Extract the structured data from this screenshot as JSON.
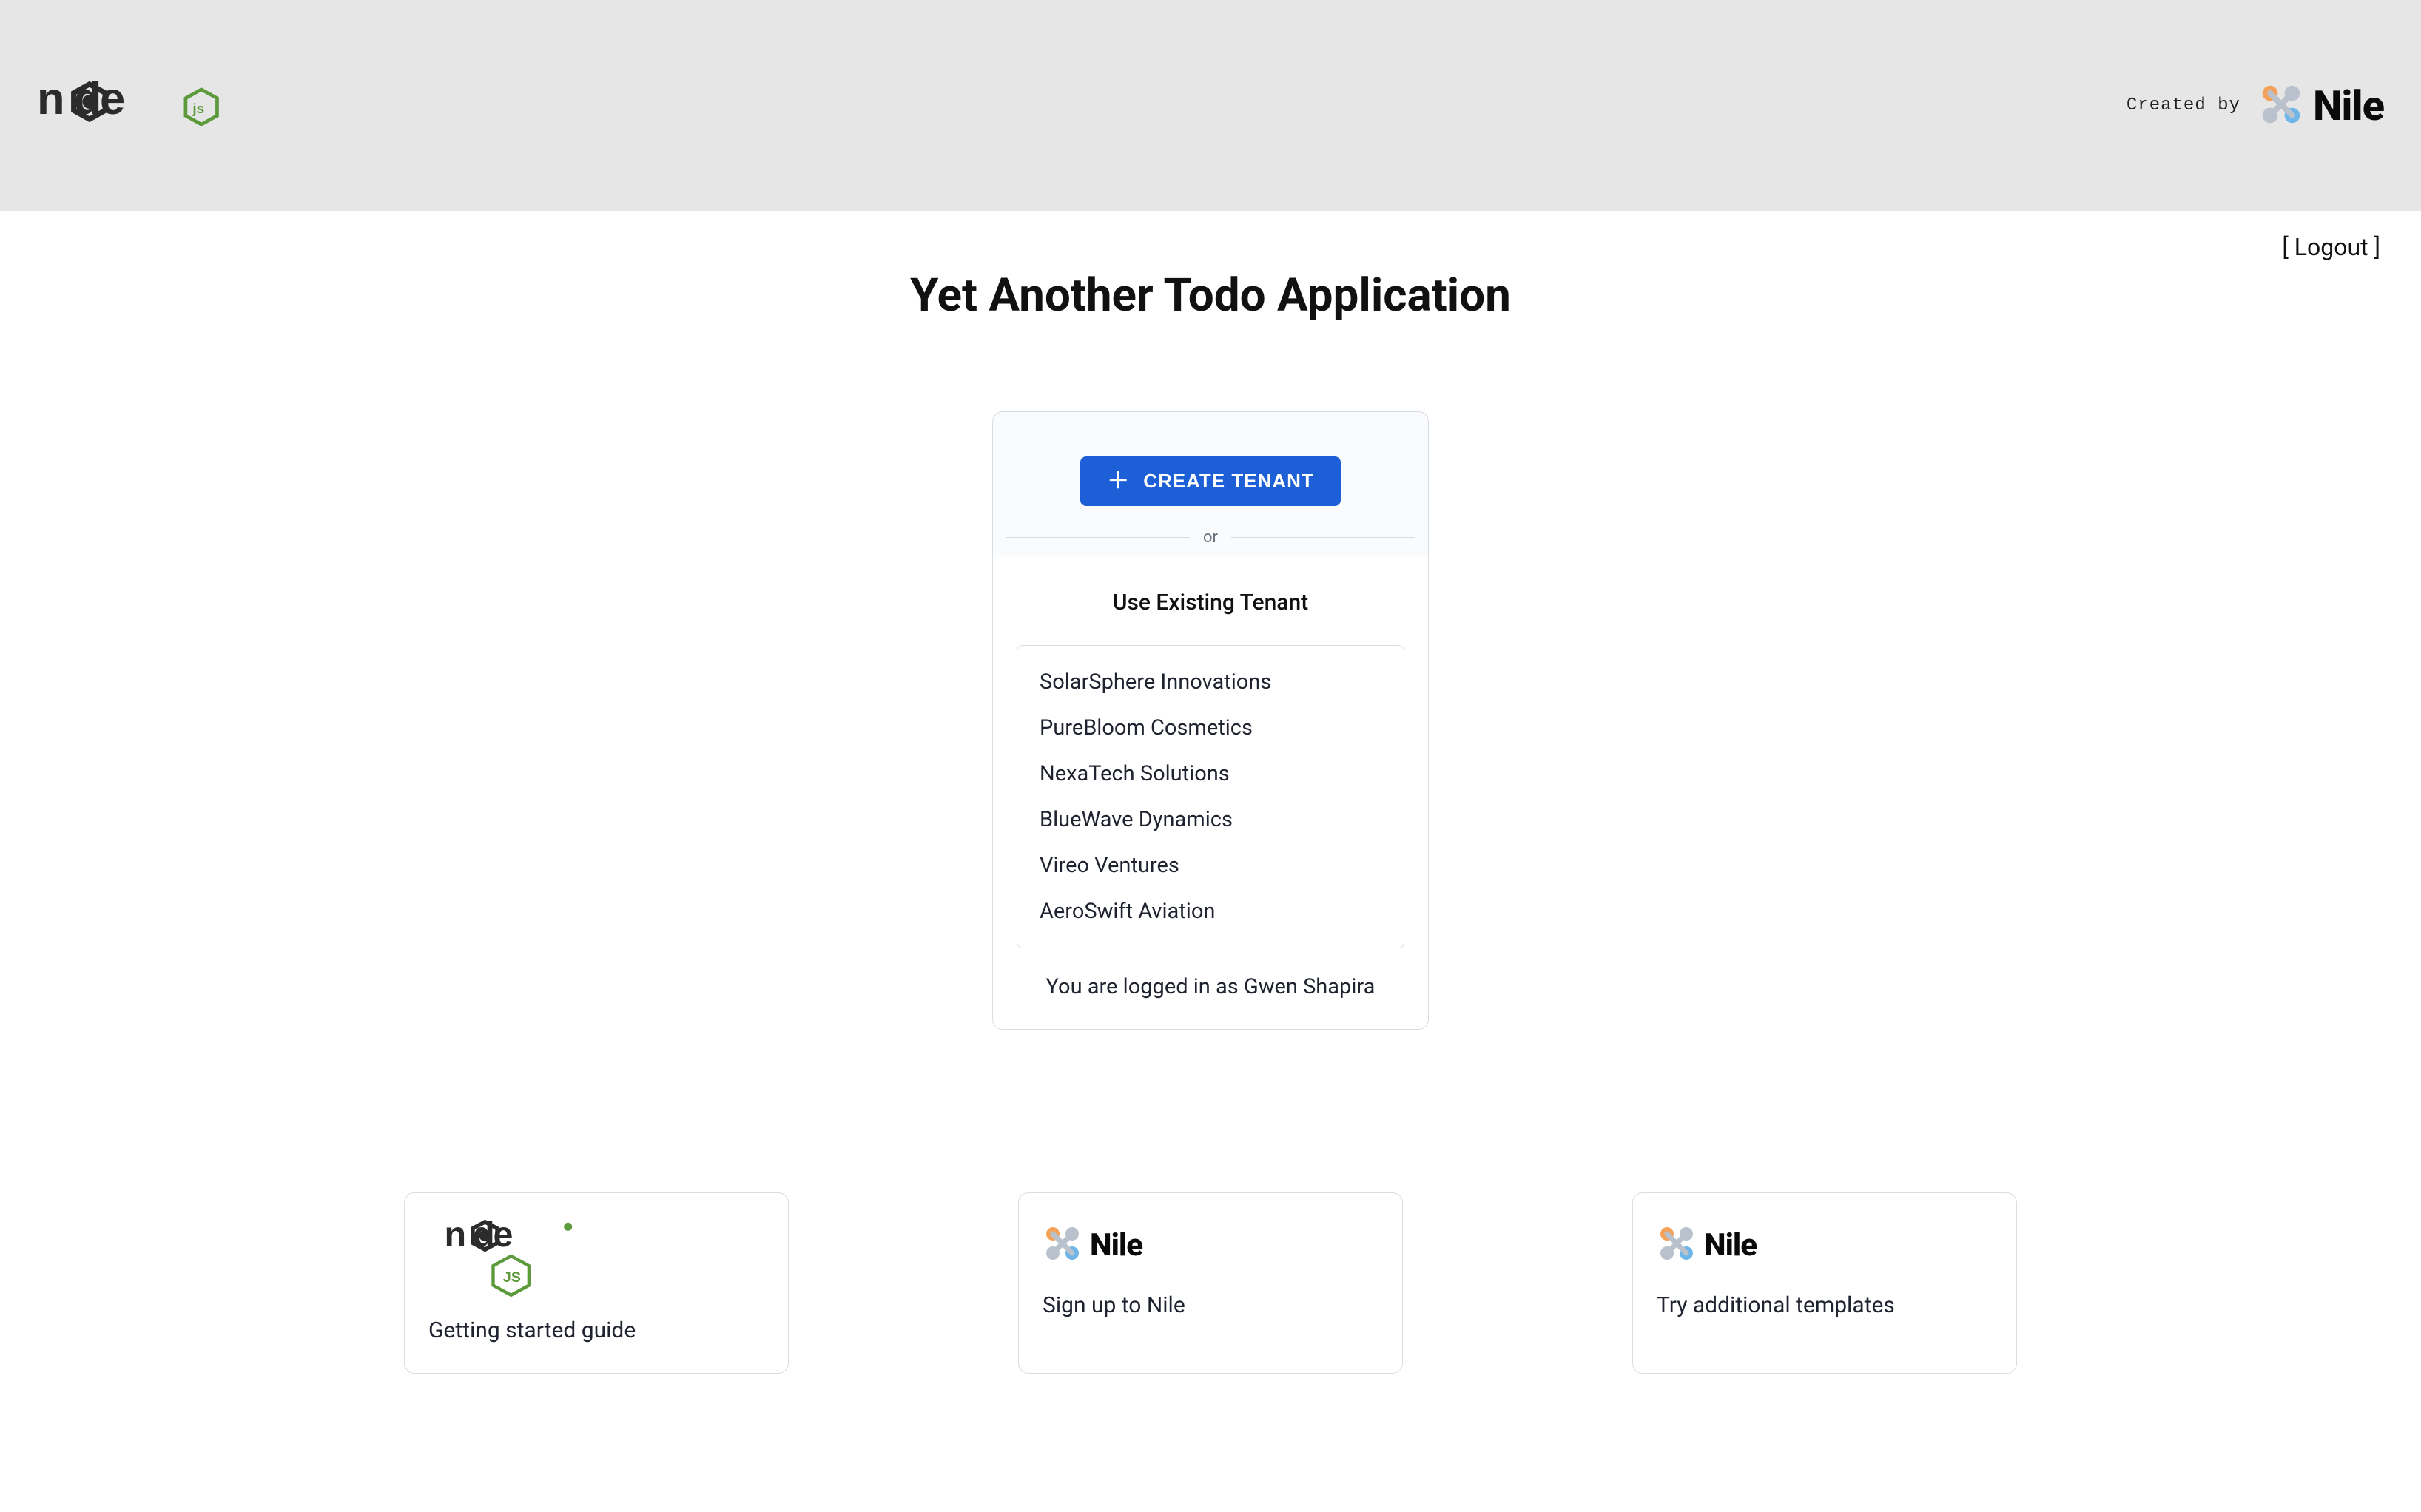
{
  "header": {
    "created_by": "Created by",
    "nile_brand": "Nile"
  },
  "logout": {
    "label": "[ Logout ]"
  },
  "page": {
    "title": "Yet Another Todo Application"
  },
  "card": {
    "create_button": "CREATE TENANT",
    "divider_text": "or",
    "existing_heading": "Use Existing Tenant",
    "tenants": [
      "SolarSphere Innovations",
      "PureBloom Cosmetics",
      "NexaTech Solutions",
      "BlueWave Dynamics",
      "Vireo Ventures",
      "AeroSwift Aviation"
    ],
    "logged_in_prefix": "You are logged in as ",
    "logged_in_user": "Gwen Shapira"
  },
  "footer": {
    "cards": [
      {
        "label": "Getting started guide",
        "logo": "node"
      },
      {
        "label": "Sign up to Nile",
        "logo": "nile"
      },
      {
        "label": "Try additional templates",
        "logo": "nile"
      }
    ]
  }
}
